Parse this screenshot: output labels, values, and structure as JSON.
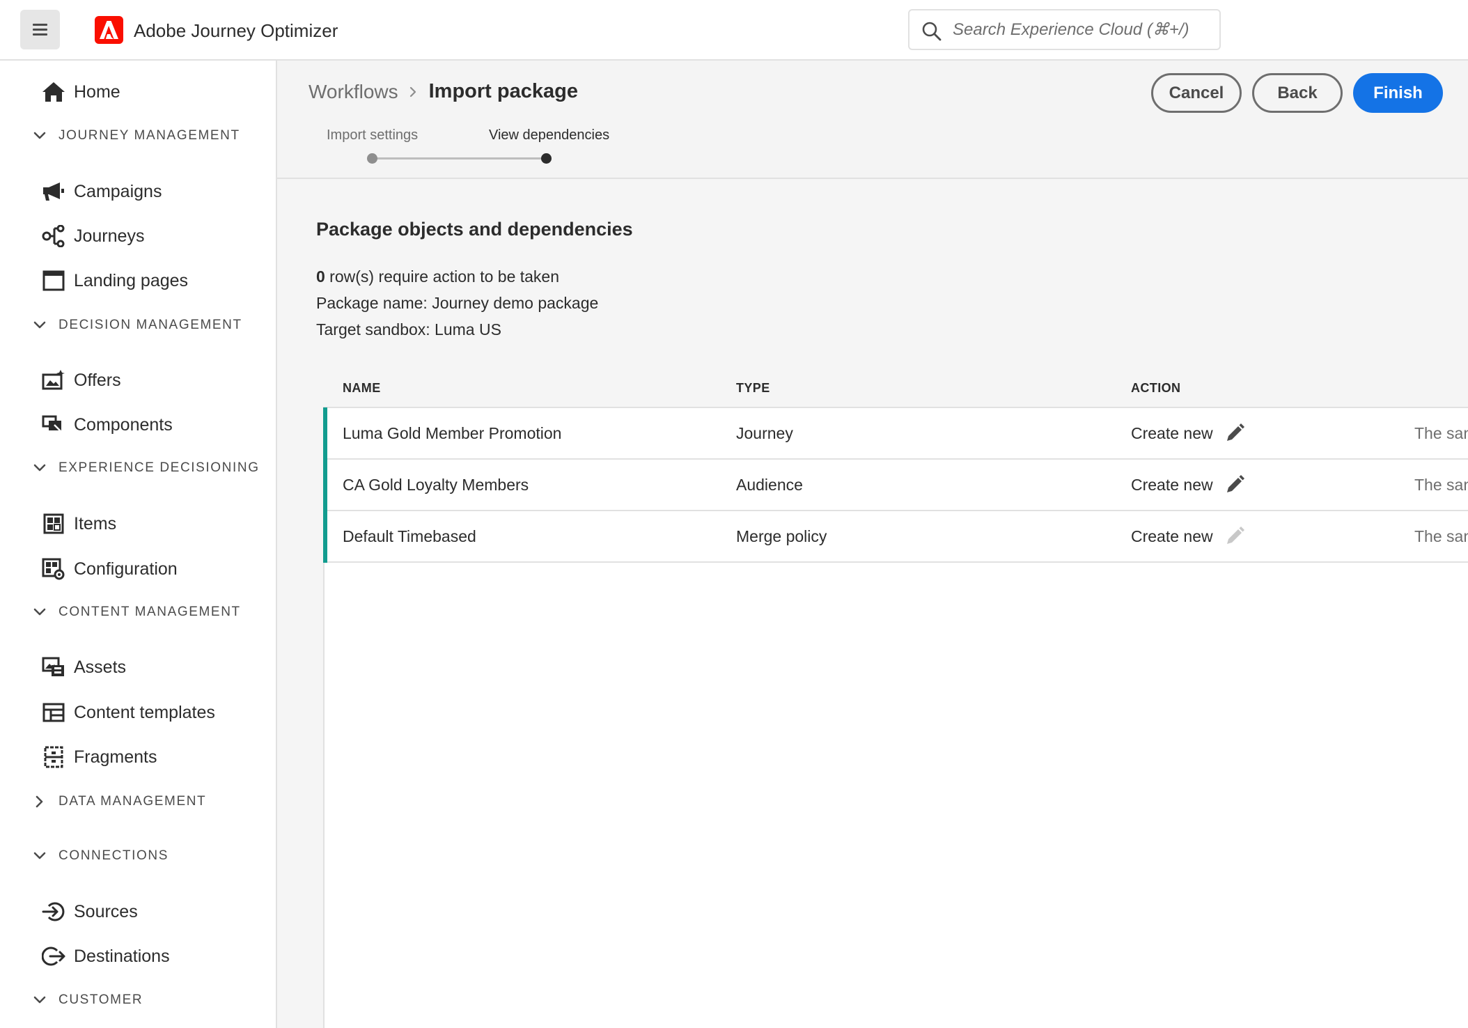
{
  "app": {
    "name": "Adobe Journey Optimizer",
    "menu_icon": "hamburger-menu-icon",
    "logo_icon": "adobe-logo-icon",
    "brand_color": "#fa0f00"
  },
  "search": {
    "placeholder": "Search Experience Cloud (⌘+/)",
    "icon": "search-icon"
  },
  "sidebar": {
    "home": {
      "label": "Home",
      "icon": "home-icon"
    },
    "journey_management": {
      "label": "JOURNEY MANAGEMENT",
      "expanded": true,
      "items": [
        {
          "label": "Campaigns",
          "icon": "megaphone-icon"
        },
        {
          "label": "Journeys",
          "icon": "journey-icon"
        },
        {
          "label": "Landing pages",
          "icon": "landing-page-icon"
        }
      ]
    },
    "decision_management": {
      "label": "DECISION MANAGEMENT",
      "expanded": true,
      "items": [
        {
          "label": "Offers",
          "icon": "offer-icon"
        },
        {
          "label": "Components",
          "icon": "components-icon"
        }
      ]
    },
    "experience_decisioning": {
      "label": "EXPERIENCE DECISIONING",
      "expanded": true,
      "items": [
        {
          "label": "Items",
          "icon": "items-icon"
        },
        {
          "label": "Configuration",
          "icon": "configuration-icon"
        }
      ]
    },
    "content_management": {
      "label": "CONTENT MANAGEMENT",
      "expanded": true,
      "items": [
        {
          "label": "Assets",
          "icon": "assets-icon"
        },
        {
          "label": "Content templates",
          "icon": "content-templates-icon"
        },
        {
          "label": "Fragments",
          "icon": "fragments-icon"
        }
      ]
    },
    "data_management": {
      "label": "DATA MANAGEMENT",
      "expanded": false
    },
    "connections": {
      "label": "CONNECTIONS",
      "expanded": true,
      "items": [
        {
          "label": "Sources",
          "icon": "sources-icon"
        },
        {
          "label": "Destinations",
          "icon": "destinations-icon"
        }
      ]
    },
    "customer": {
      "label": "CUSTOMER",
      "expanded": true
    }
  },
  "header": {
    "breadcrumb_parent": "Workflows",
    "breadcrumb_current": "Import package",
    "cancel_label": "Cancel",
    "back_label": "Back",
    "finish_label": "Finish",
    "accent_color": "#1473e6"
  },
  "steps": [
    {
      "label": "Import settings",
      "state": "complete"
    },
    {
      "label": "View dependencies",
      "state": "current"
    }
  ],
  "content": {
    "title": "Package objects and dependencies",
    "rows_action_count": "0",
    "rows_action_text": " row(s) require action to be taken",
    "package_name_line": "Package name: Journey demo package",
    "target_sandbox_line": "Target sandbox: Luma US"
  },
  "table": {
    "columns": [
      "NAME",
      "TYPE",
      "ACTION"
    ],
    "row_accent_color": "#129c8f",
    "rows": [
      {
        "name": "Luma Gold Member Promotion",
        "type": "Journey",
        "action": "Create new",
        "description": "The san",
        "edit_enabled": true
      },
      {
        "name": "CA Gold Loyalty Members",
        "type": "Audience",
        "action": "Create new",
        "description": "The san",
        "edit_enabled": true
      },
      {
        "name": "Default Timebased",
        "type": "Merge policy",
        "action": "Create new",
        "description": "The san",
        "edit_enabled": false
      }
    ]
  }
}
